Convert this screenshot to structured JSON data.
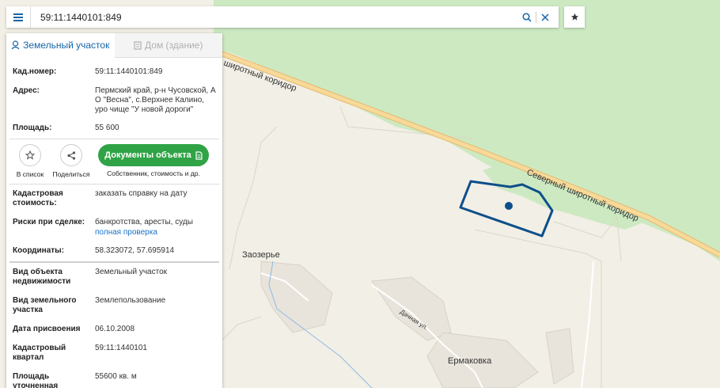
{
  "search": {
    "value": "59:11:1440101:849",
    "menu_icon": "menu-icon",
    "search_icon": "search-icon",
    "clear_icon": "close-icon",
    "favorite_icon": "star-icon"
  },
  "panel": {
    "tabs": [
      {
        "label": "Земельный участок",
        "icon": "land-plot-icon",
        "active": true
      },
      {
        "label": "Дом (здание)",
        "icon": "building-icon",
        "active": false
      }
    ],
    "fields_top": [
      {
        "key": "Кад.номер:",
        "value": "59:11:1440101:849"
      },
      {
        "key": "Адрес:",
        "value": "Пермский край, р-н Чусовской, А О \"Весна\", с.Верхнее Калино, уро чище \"У новой дороги\""
      },
      {
        "key": "Площадь:",
        "value": "55 600"
      }
    ],
    "actions": {
      "add_to_list": "В список",
      "share": "Поделиться",
      "documents_button": "Документы объекта",
      "documents_sub": "Собственник, стоимость и др."
    },
    "cadastral_value": {
      "key": "Кадастровая стоимость:",
      "link": "заказать справку на дату"
    },
    "risks": {
      "key": "Риски при сделке:",
      "value": "банкротства, аресты, суды",
      "link": "полная проверка"
    },
    "coordinates": {
      "key": "Координаты:",
      "value": "58.323072, 57.695914"
    },
    "fields_bottom": [
      {
        "key": "Вид объекта недвижимости",
        "value": "Земельный участок"
      },
      {
        "key": "Вид земельного участка",
        "value": "Землепользование"
      },
      {
        "key": "Дата присвоения",
        "value": "06.10.2008"
      },
      {
        "key": "Кадастровый квартал",
        "value": "59:11:1440101"
      },
      {
        "key": "Площадь уточненная",
        "value": "55600 кв. м"
      }
    ]
  },
  "map": {
    "road_label_1": "Северный широтный коридор",
    "road_label_2": "широтный коридор",
    "street_label": "Дачная ул.",
    "place_1": "Заозерье",
    "place_2": "Ермаковка"
  },
  "colors": {
    "accent": "#1565a6",
    "forest": "#cde9c2",
    "road": "#f3cf87",
    "parcel": "#0d4f8a",
    "docs_button": "#2fa346"
  }
}
